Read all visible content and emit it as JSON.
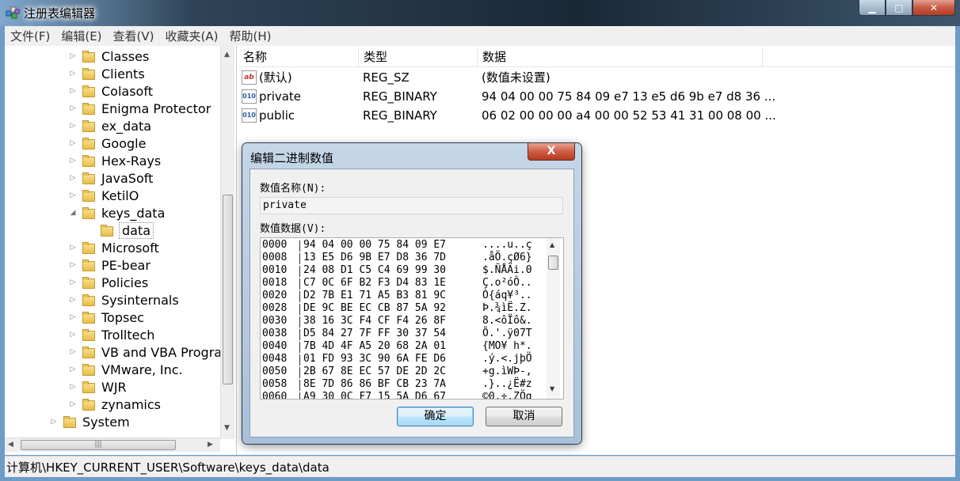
{
  "window": {
    "title": "注册表编辑器"
  },
  "menu": [
    "文件(F)",
    "编辑(E)",
    "查看(V)",
    "收藏夹(A)",
    "帮助(H)"
  ],
  "tree": [
    {
      "label": "Classes",
      "level": 1,
      "expander": "▷"
    },
    {
      "label": "Clients",
      "level": 1,
      "expander": "▷"
    },
    {
      "label": "Colasoft",
      "level": 1,
      "expander": "▷"
    },
    {
      "label": "Enigma Protector",
      "level": 1,
      "expander": "▷"
    },
    {
      "label": "ex_data",
      "level": 1,
      "expander": "▷"
    },
    {
      "label": "Google",
      "level": 1,
      "expander": "▷"
    },
    {
      "label": "Hex-Rays",
      "level": 1,
      "expander": "▷"
    },
    {
      "label": "JavaSoft",
      "level": 1,
      "expander": "▷"
    },
    {
      "label": "KetilO",
      "level": 1,
      "expander": "▷"
    },
    {
      "label": "keys_data",
      "level": 1,
      "expander": "◢"
    },
    {
      "label": "data",
      "level": 2,
      "expander": "",
      "selected": true
    },
    {
      "label": "Microsoft",
      "level": 1,
      "expander": "▷"
    },
    {
      "label": "PE-bear",
      "level": 1,
      "expander": "▷"
    },
    {
      "label": "Policies",
      "level": 1,
      "expander": "▷"
    },
    {
      "label": "Sysinternals",
      "level": 1,
      "expander": "▷"
    },
    {
      "label": "Topsec",
      "level": 1,
      "expander": "▷"
    },
    {
      "label": "Trolltech",
      "level": 1,
      "expander": "▷"
    },
    {
      "label": "VB and VBA Program",
      "level": 1,
      "expander": "▷"
    },
    {
      "label": "VMware, Inc.",
      "level": 1,
      "expander": "▷"
    },
    {
      "label": "WJR",
      "level": 1,
      "expander": "▷"
    },
    {
      "label": "zynamics",
      "level": 1,
      "expander": "▷"
    },
    {
      "label": "System",
      "level": 0,
      "expander": "▷"
    }
  ],
  "list": {
    "headers": [
      "名称",
      "类型",
      "数据"
    ],
    "rows": [
      {
        "icon": "ab",
        "kind": "str",
        "name": "(默认)",
        "type": "REG_SZ",
        "data": "(数值未设置)"
      },
      {
        "icon": "010",
        "kind": "bin",
        "name": "private",
        "type": "REG_BINARY",
        "data": "94 04 00 00 75 84 09 e7 13 e5 d6 9b e7 d8 36 ..."
      },
      {
        "icon": "010",
        "kind": "bin",
        "name": "public",
        "type": "REG_BINARY",
        "data": "06 02 00 00 00 a4 00 00 52 53 41 31 00 08 00 ..."
      }
    ]
  },
  "status": "计算机\\HKEY_CURRENT_USER\\Software\\keys_data\\data",
  "dialog": {
    "title": "编辑二进制数值",
    "close": "X",
    "name_label": "数值名称(N):",
    "name_value": "private",
    "data_label": "数值数据(V):",
    "hex_rows": [
      {
        "addr": "0000",
        "bytes": "94 04 00 00 75 84 09 E7",
        "ascii": "....u..ç"
      },
      {
        "addr": "0008",
        "bytes": "13 E5 D6 9B E7 D8 36 7D",
        "ascii": ".åÖ.çØ6}"
      },
      {
        "addr": "0010",
        "bytes": "24 08 D1 C5 C4 69 99 30",
        "ascii": "$.ÑÅÄi.0"
      },
      {
        "addr": "0018",
        "bytes": "C7 0C 6F B2 F3 D4 83 1E",
        "ascii": "Ç.o²óÔ.."
      },
      {
        "addr": "0020",
        "bytes": "D2 7B E1 71 A5 B3 81 9C",
        "ascii": "Ò{áq¥³.."
      },
      {
        "addr": "0028",
        "bytes": "DE 9C BE EC CB 87 5A 92",
        "ascii": "Þ.¾ìË.Z."
      },
      {
        "addr": "0030",
        "bytes": "38 16 3C F4 CF F4 26 8F",
        "ascii": "8.<ôÏô&."
      },
      {
        "addr": "0038",
        "bytes": "D5 84 27 7F FF 30 37 54",
        "ascii": "Õ.'.ÿ07T"
      },
      {
        "addr": "0040",
        "bytes": "7B 4D 4F A5 20 68 2A 01",
        "ascii": "{MO¥ h*."
      },
      {
        "addr": "0048",
        "bytes": "01 FD 93 3C 90 6A FE D6",
        "ascii": ".ý.<.jþÖ"
      },
      {
        "addr": "0050",
        "bytes": "2B 67 8E EC 57 DE 2D 2C",
        "ascii": "+g.ìWÞ-,"
      },
      {
        "addr": "0058",
        "bytes": "8E 7D 86 86 BF CB 23 7A",
        "ascii": ".}..¿Ë#z"
      },
      {
        "addr": "0060",
        "bytes": "A9 30 0C F7 15 5A D6 67",
        "ascii": "©0.÷.ZÖg"
      }
    ],
    "ok": "确定",
    "cancel": "取消"
  }
}
